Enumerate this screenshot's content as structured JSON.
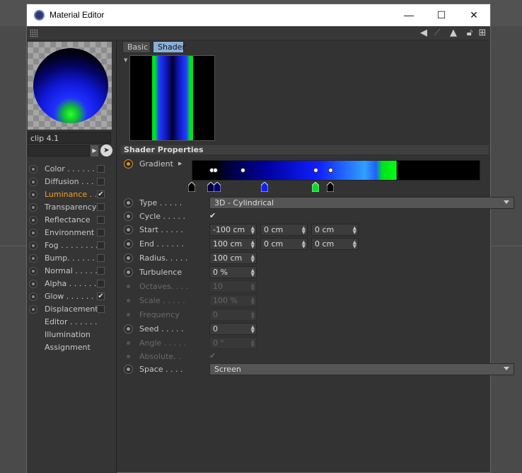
{
  "window": {
    "title": "Material Editor",
    "controls": {
      "minimize": "—",
      "maximize": "☐",
      "close": "✕"
    }
  },
  "material": {
    "name": "clip 4.1"
  },
  "channels": [
    {
      "label": "Color . . . . . . .",
      "checked": false
    },
    {
      "label": "Diffusion . . . .",
      "checked": false
    },
    {
      "label": "Luminance . . .",
      "checked": true,
      "active": true
    },
    {
      "label": "Transparency",
      "checked": false
    },
    {
      "label": "Reflectance",
      "checked": false
    },
    {
      "label": "Environment",
      "checked": false
    },
    {
      "label": "Fog . . . . . . . .",
      "checked": false
    },
    {
      "label": "Bump. . . . . . .",
      "checked": false
    },
    {
      "label": "Normal . . . . .",
      "checked": false
    },
    {
      "label": "Alpha . . . . . .",
      "checked": false
    },
    {
      "label": "Glow . . . . . . .",
      "checked": true
    },
    {
      "label": "Displacement",
      "checked": false
    },
    {
      "label": "Editor . . . . . ."
    },
    {
      "label": "Illumination"
    },
    {
      "label": "Assignment"
    }
  ],
  "tabs": {
    "basic": "Basic",
    "shader": "Shader"
  },
  "section": {
    "title": "Shader Properties"
  },
  "params": {
    "gradient": "Gradient",
    "type": {
      "label": "Type . . . . .",
      "value": "3D - Cylindrical"
    },
    "cycle": {
      "label": "Cycle . . . . .",
      "check": "✔"
    },
    "start": {
      "label": "Start . . . . .",
      "x": "-100 cm",
      "y": "0 cm",
      "z": "0 cm"
    },
    "end": {
      "label": "End . . . . . .",
      "x": "100 cm",
      "y": "0 cm",
      "z": "0 cm"
    },
    "radius": {
      "label": "Radius. . . . .",
      "value": "100 cm"
    },
    "turbulence": {
      "label": "Turbulence",
      "value": "0 %"
    },
    "octaves": {
      "label": "Octaves. . . .",
      "value": "10"
    },
    "scale": {
      "label": "Scale . . . . .",
      "value": "100 %"
    },
    "frequency": {
      "label": "Frequency",
      "value": "0"
    },
    "seed": {
      "label": "Seed . . . . .",
      "value": "0"
    },
    "angle": {
      "label": "Angle . . . . .",
      "value": "0 °"
    },
    "absolute": {
      "label": "Absolute. .",
      "check": "✔"
    },
    "space": {
      "label": "Space . . . .",
      "value": "Screen"
    }
  },
  "colors": {
    "accent": "#f0a020",
    "tab_active": "#8aaed8",
    "knot_colors": [
      "#000000",
      "#00003a",
      "#000070",
      "#1020ff",
      "#00e020",
      "#000000"
    ]
  }
}
